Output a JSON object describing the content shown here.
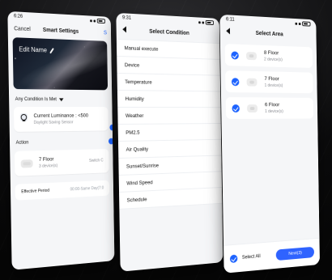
{
  "colors": {
    "accent": "#1d63ff",
    "button": "#2f63ff",
    "screen_bg": "#f5f6f8",
    "card_bg": "#ffffff",
    "muted_text": "#8d8f95"
  },
  "phone1": {
    "status_time": "6:26",
    "nav": {
      "left": "Cancel",
      "title": "Smart Settings",
      "right": "S"
    },
    "hero": {
      "label": "Edit Name"
    },
    "condition_header": "Any Condition Is Met",
    "condition": {
      "title": "Current Luminance : <500",
      "subtitle": "Daylight Saving Sensor"
    },
    "action_header": "Action",
    "action": {
      "title": "7 Floor",
      "subtitle": "3 device(s)",
      "right": "Switch C"
    },
    "effective": {
      "label": "Effective Period",
      "value": "00:00-Same Day(7:0"
    }
  },
  "phone2": {
    "status_time": "9:31",
    "nav": {
      "title": "Select Condition"
    },
    "items": [
      "Manual execute",
      "Device",
      "Temperature",
      "Humidity",
      "Weather",
      "PM2.5",
      "Air Quality",
      "Sunset/Sunrise",
      "Wind Speed",
      "Schedule"
    ]
  },
  "phone3": {
    "status_time": "6:11",
    "nav": {
      "title": "Select Area"
    },
    "areas": [
      {
        "name": "8 Floor",
        "devices": "2 device(s)"
      },
      {
        "name": "7 Floor",
        "devices": "1 device(s)"
      },
      {
        "name": "6 Floor",
        "devices": "1 device(s)"
      }
    ],
    "bottom": {
      "select_all": "Select All",
      "next": "Next(3)"
    }
  },
  "icons": {
    "edit": "pencil-icon",
    "dropdown": "chevron-down-icon",
    "sensor": "bulb-icon",
    "back": "back-icon",
    "check": "check-icon",
    "floor": "floor-tile-icon"
  }
}
